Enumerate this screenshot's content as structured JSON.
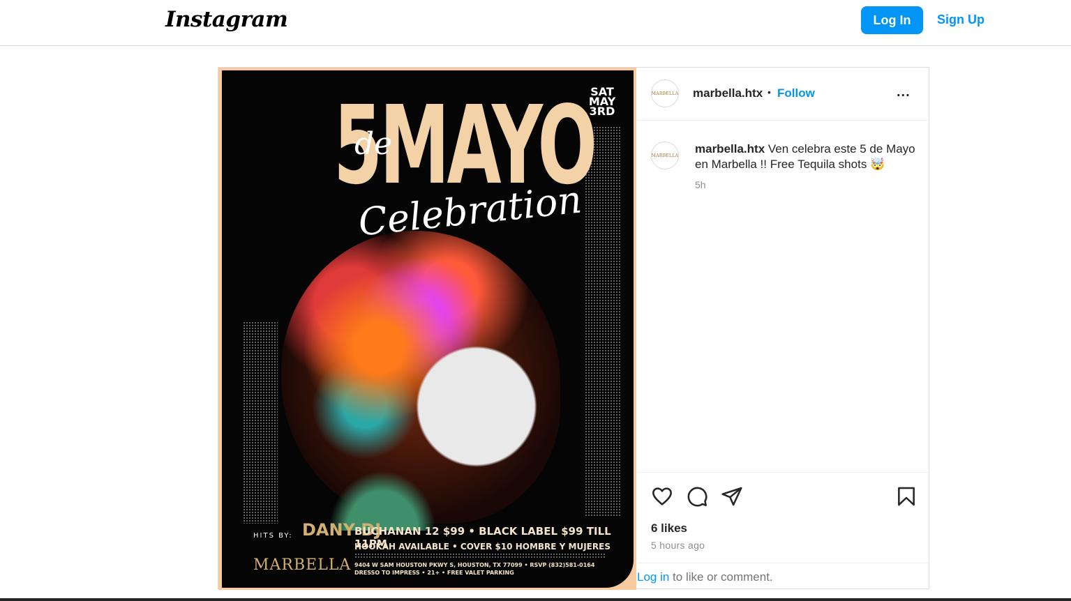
{
  "header": {
    "logo_text": "Instagram",
    "login_label": "Log In",
    "signup_label": "Sign Up"
  },
  "post": {
    "flyer": {
      "title_main": "5MAYO",
      "title_de": "de",
      "title_celebration": "Celebration",
      "date": "SAT MAY 3RD",
      "hits_by": "HITS BY:",
      "dj_name": "DANY DJ",
      "brand": "MARBELLA",
      "line1": "BUCHANAN 12 $99 • BLACK LABEL $99 TILL 11PM",
      "line2": "HOOKAH AVAILABLE • COVER $10 HOMBRE Y MUJERES",
      "line3": "9404 W SAM HOUSTON PKWY S, HOUSTON, TX 77099 • RSVP (832)581-0164",
      "line4": "DRESSO TO IMPRESS • 21+ • FREE VALET PARKING"
    },
    "author": {
      "username": "marbella.htx",
      "avatar_text": "MARBELLA",
      "follow_label": "Follow",
      "more_label": "..."
    },
    "caption": {
      "username": "marbella.htx",
      "text": "Ven celebra este 5 de Mayo en Marbella !! Free Tequila shots 🤯",
      "time": "5h"
    },
    "stats": {
      "likes": "6 likes",
      "posted_ago": "5 hours ago"
    },
    "comment_bar": {
      "login_link": "Log in",
      "rest_text": " to like or comment."
    }
  },
  "icons": {
    "like": "heart-icon",
    "comment": "comment-icon",
    "share": "share-icon",
    "save": "bookmark-icon"
  },
  "colors": {
    "accent": "#0095f6",
    "text": "#262626",
    "muted": "#8e8e8e",
    "border": "#dbdbdb"
  }
}
